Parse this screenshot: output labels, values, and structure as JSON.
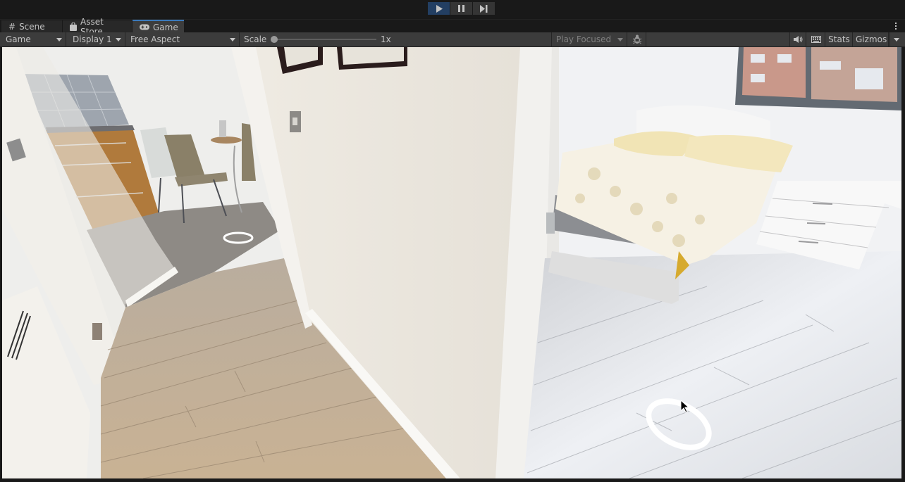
{
  "playbar": {
    "buttons": [
      {
        "id": "play",
        "icon": "play-icon",
        "active": true
      },
      {
        "id": "pause",
        "icon": "pause-icon",
        "active": false
      },
      {
        "id": "step",
        "icon": "step-forward-icon",
        "active": false
      }
    ]
  },
  "tabs": [
    {
      "label": "Scene",
      "icon": "grid-icon",
      "active": false
    },
    {
      "label": "Asset Store",
      "icon": "shopping-bag-icon",
      "active": false
    },
    {
      "label": "Game",
      "icon": "gamepad-icon",
      "active": true
    }
  ],
  "toolbar": {
    "view_select": "Game",
    "display_select": "Display 1",
    "aspect_select": "Free Aspect",
    "scale_label": "Scale",
    "scale_value": "1x",
    "scale_fraction": 0.0,
    "play_mode_select": "Play Focused",
    "stats_label": "Stats",
    "gizmos_label": "Gizmos"
  },
  "viewport": {
    "description": "360 panorama of apartment hallway: kitchen with dining chairs on the left, white hallway wall in center, bedroom with double bed and white nightstand on the right",
    "teleport_markers": 2,
    "colors": {
      "wall": "#ece8e0",
      "floor_wood": "#c8b49a",
      "floor_grey": "#d8dbe0",
      "cabinet": "#b07a3c",
      "bedspread_accent": "#d6aa2e",
      "window_frame": "#6a6f76"
    }
  }
}
